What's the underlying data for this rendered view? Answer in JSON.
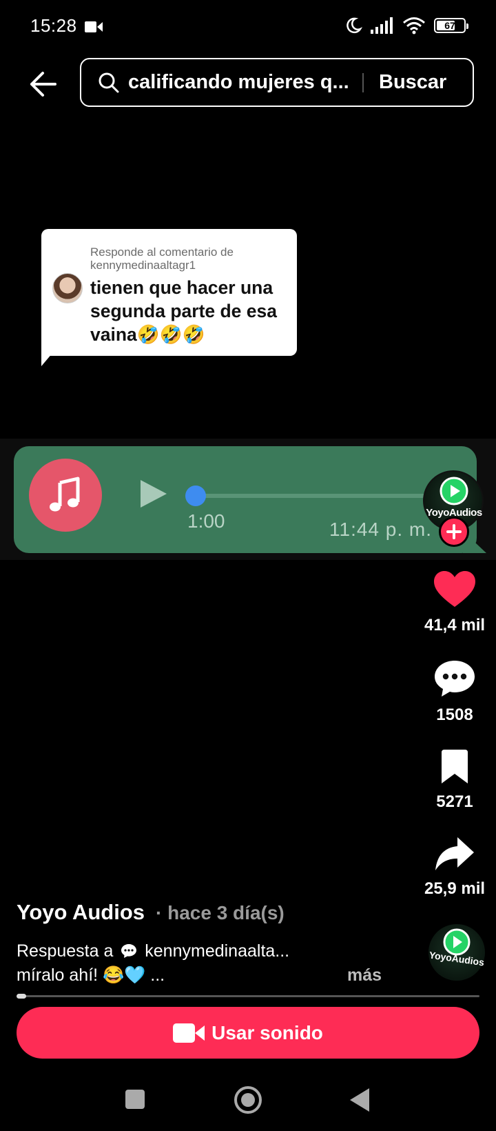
{
  "status_bar": {
    "time": "15:28",
    "battery": "67",
    "icons": [
      "video-camera-icon",
      "moon-icon",
      "signal-icon",
      "wifi-icon",
      "battery-icon"
    ]
  },
  "search": {
    "query": "calificando mujeres q...",
    "button": "Buscar"
  },
  "comment_card": {
    "reply_to": "Responde al comentario de kennymedinaaltagr1",
    "text": "tienen que hacer una segunda parte de esa vaina🤣🤣🤣"
  },
  "audio_message": {
    "duration": "1:00",
    "time": "11:44 p. m."
  },
  "creator_badge": {
    "brand": "YoyoAudios"
  },
  "actions": {
    "likes": "41,4 mil",
    "comments": "1508",
    "saves": "5271",
    "shares": "25,9 mil"
  },
  "post": {
    "author": "Yoyo Audios",
    "when": "· hace 3 día(s)",
    "caption_prefix": "Respuesta a",
    "caption_user": "kennymedinaalta...",
    "caption_line2": "míralo ahí! 😂🩵 ...",
    "more": "más",
    "progress": 0.01
  },
  "use_sound": {
    "label": "Usar sonido"
  },
  "colors": {
    "accent": "#fe2c55",
    "bubble": "#3b7a5a",
    "music_circle": "#e5566a",
    "knob": "#3e8cf0"
  }
}
